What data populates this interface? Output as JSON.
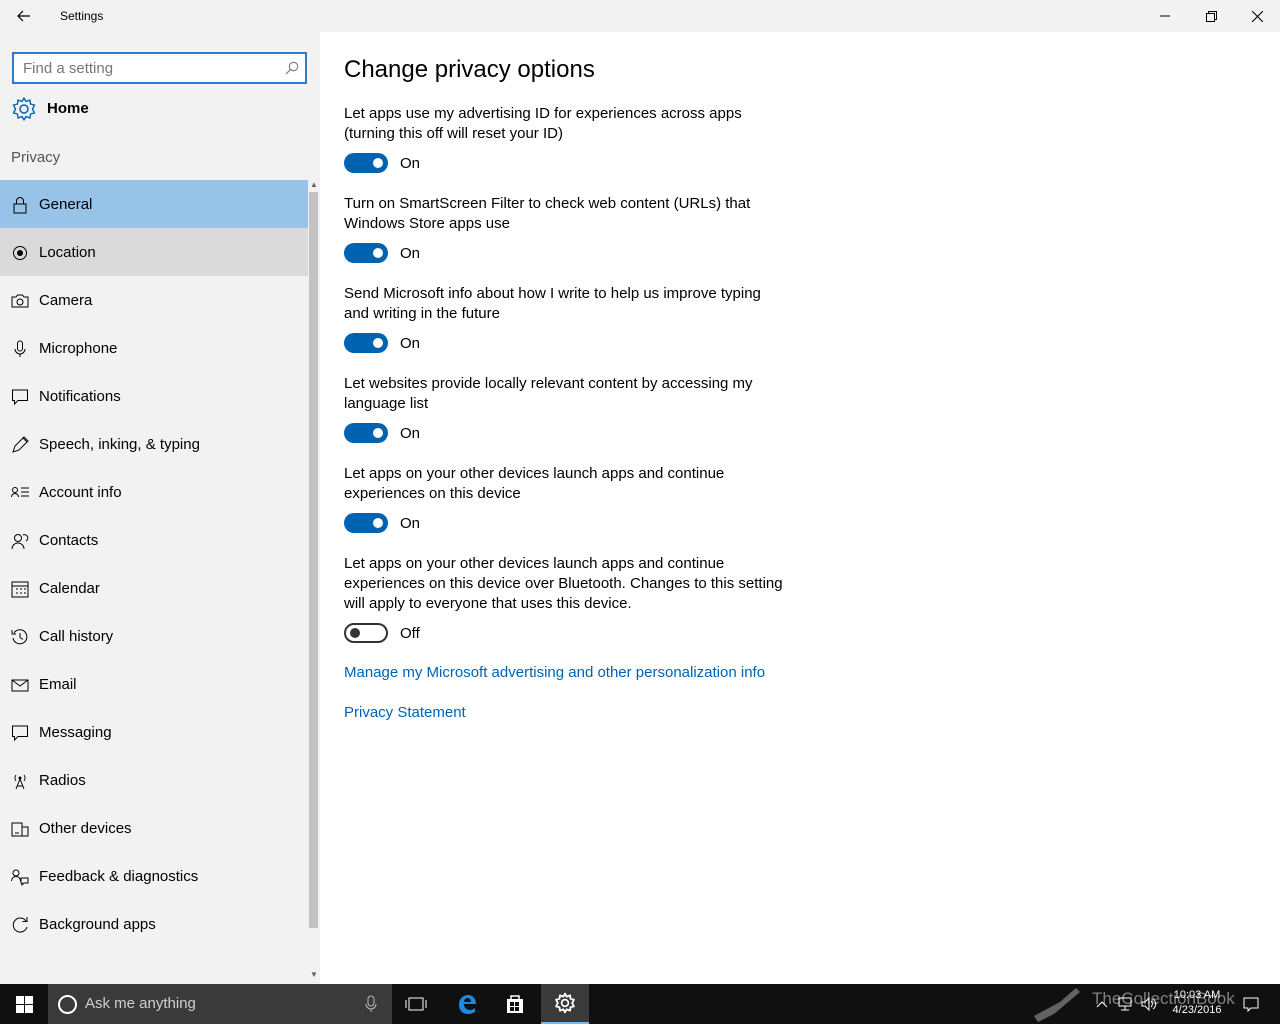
{
  "window": {
    "title": "Settings",
    "back_icon": "back-arrow-icon",
    "controls": [
      "minimize-icon",
      "restore-icon",
      "close-icon"
    ]
  },
  "sidebar": {
    "search_placeholder": "Find a setting",
    "home_label": "Home",
    "section_label": "Privacy",
    "items": [
      {
        "label": "General",
        "icon": "lock-icon",
        "state": "selected"
      },
      {
        "label": "Location",
        "icon": "location-icon",
        "state": "hover"
      },
      {
        "label": "Camera",
        "icon": "camera-icon",
        "state": ""
      },
      {
        "label": "Microphone",
        "icon": "microphone-icon",
        "state": ""
      },
      {
        "label": "Notifications",
        "icon": "notifications-icon",
        "state": ""
      },
      {
        "label": "Speech, inking, & typing",
        "icon": "speech-icon",
        "state": ""
      },
      {
        "label": "Account info",
        "icon": "account-info-icon",
        "state": ""
      },
      {
        "label": "Contacts",
        "icon": "contacts-icon",
        "state": ""
      },
      {
        "label": "Calendar",
        "icon": "calendar-icon",
        "state": ""
      },
      {
        "label": "Call history",
        "icon": "call-history-icon",
        "state": ""
      },
      {
        "label": "Email",
        "icon": "email-icon",
        "state": ""
      },
      {
        "label": "Messaging",
        "icon": "messaging-icon",
        "state": ""
      },
      {
        "label": "Radios",
        "icon": "radios-icon",
        "state": ""
      },
      {
        "label": "Other devices",
        "icon": "other-devices-icon",
        "state": ""
      },
      {
        "label": "Feedback & diagnostics",
        "icon": "feedback-icon",
        "state": ""
      },
      {
        "label": "Background apps",
        "icon": "background-apps-icon",
        "state": ""
      }
    ]
  },
  "main": {
    "title": "Change privacy options",
    "settings": [
      {
        "lines": [
          "Let apps use my advertising ID for experiences across apps",
          "(turning this off will reset your ID)"
        ],
        "on": true,
        "state_label": "On"
      },
      {
        "lines": [
          "Turn on SmartScreen Filter to check web content (URLs) that",
          "Windows Store apps use"
        ],
        "on": true,
        "state_label": "On"
      },
      {
        "lines": [
          "Send Microsoft info about how I write to help us improve typing",
          "and writing in the future"
        ],
        "on": true,
        "state_label": "On"
      },
      {
        "lines": [
          "Let websites provide locally relevant content by accessing my",
          "language list"
        ],
        "on": true,
        "state_label": "On"
      },
      {
        "lines": [
          "Let apps on your other devices launch apps and continue",
          "experiences on this device"
        ],
        "on": true,
        "state_label": "On"
      },
      {
        "lines": [
          "Let apps on your other devices launch apps and continue",
          "experiences on this device over Bluetooth. Changes to this setting",
          "will apply to everyone that uses this device."
        ],
        "on": false,
        "state_label": "Off"
      }
    ],
    "links": [
      "Manage my Microsoft advertising and other personalization info",
      "Privacy Statement"
    ],
    "accent_color": "#0063b1"
  },
  "taskbar": {
    "search_placeholder": "Ask me anything",
    "time": "10:03 AM",
    "date": "4/23/2016",
    "watermark": "TheCollectionBook"
  }
}
